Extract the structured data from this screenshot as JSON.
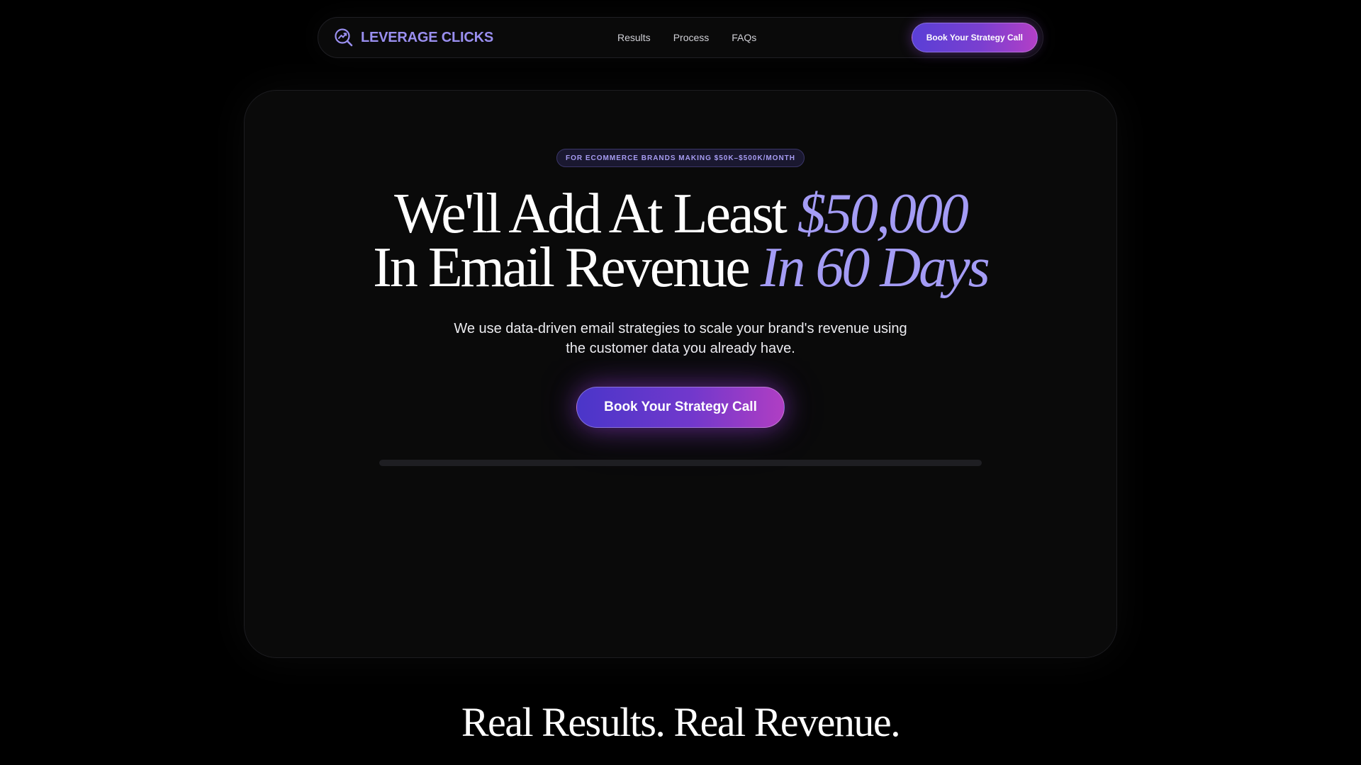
{
  "nav": {
    "brand_name": "LEVERAGE CLICKS",
    "brand_icon": "chart-trend-magnifier-icon",
    "links": [
      {
        "label": "Results"
      },
      {
        "label": "Process"
      },
      {
        "label": "FAQs"
      }
    ],
    "cta_label": "Book Your Strategy Call"
  },
  "hero": {
    "badge": "FOR ECOMMERCE BRANDS MAKING $50K–$500K/MONTH",
    "headline_line1_plain": "We'll Add At Least ",
    "headline_line1_accent": "$50,000",
    "headline_line2_plain": "In Email Revenue ",
    "headline_line2_accent": "In 60 Days",
    "subheadline_line1": "We use data-driven email strategies to scale your brand's revenue using",
    "subheadline_line2": "the customer data you already have.",
    "cta_label": "Book Your Strategy Call",
    "progress_percent": 0
  },
  "results_section": {
    "title": "Real Results. Real Revenue."
  },
  "colors": {
    "accent": "#a49cf5",
    "background": "#000000",
    "card": "#0a0a0a",
    "cta_gradient_start": "#4a36c9",
    "cta_gradient_end": "#b03ec3"
  }
}
